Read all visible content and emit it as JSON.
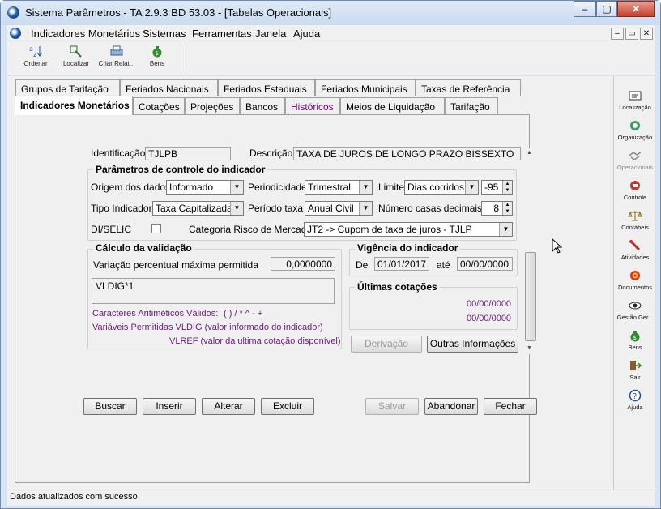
{
  "window": {
    "title": "Sistema Parâmetros -  TA 2.9.3 BD 53.03 - [Tabelas Operacionais]",
    "min_label": "‒",
    "max_label": "▢",
    "close_label": "✕"
  },
  "menubar": {
    "items": [
      "Indicadores Monetários",
      "Sistemas",
      "Ferramentas",
      "Janela",
      "Ajuda"
    ],
    "mdi_min": "‒",
    "mdi_restore": "▭",
    "mdi_close": "✕"
  },
  "toolbar": {
    "items": [
      {
        "label": "Ordenar",
        "icon": "sort-az-icon"
      },
      {
        "label": "Localizar",
        "icon": "find-icon"
      },
      {
        "label": "Criar Relat...",
        "icon": "printer-icon"
      },
      {
        "label": "Bens",
        "icon": "money-bag-icon"
      }
    ]
  },
  "sidebar": {
    "items": [
      {
        "label": "Localização",
        "icon": "location-icon"
      },
      {
        "label": "Organização",
        "icon": "organization-icon"
      },
      {
        "label": "Operacionais",
        "icon": "handshake-icon"
      },
      {
        "label": "Controle",
        "icon": "control-icon"
      },
      {
        "label": "Contábeis",
        "icon": "scale-icon"
      },
      {
        "label": "Atividades",
        "icon": "activities-icon"
      },
      {
        "label": "Documentos",
        "icon": "documents-icon"
      },
      {
        "label": "Gestão Ger...",
        "icon": "management-icon"
      },
      {
        "label": "Bens",
        "icon": "money-bag-icon"
      },
      {
        "label": "Sair",
        "icon": "exit-icon"
      },
      {
        "label": "Ajuda",
        "icon": "help-icon"
      }
    ]
  },
  "tabs": {
    "row1": [
      "Grupos de Tarifação",
      "Feriados Nacionais",
      "Feriados Estaduais",
      "Feriados Municipais",
      "Taxas de Referência"
    ],
    "row2": [
      "Indicadores Monetários",
      "Cotações",
      "Projeções",
      "Bancos",
      "Históricos",
      "Meios de Liquidação",
      "Tarifação"
    ]
  },
  "form": {
    "identificacao_label": "Identificação",
    "identificacao_value": "TJLPB",
    "descricao_label": "Descrição",
    "descricao_value": "TAXA DE JUROS DE LONGO PRAZO BISSEXTO",
    "params_title": "Parâmetros de controle do indicador",
    "origem_label": "Origem dos dados",
    "origem_value": "Informado",
    "periodicidade_label": "Periodicidade",
    "periodicidade_value": "Trimestral",
    "limite_label": "Limite",
    "limite_value": "Dias corridos",
    "limite_num": "-95",
    "tipo_label": "Tipo Indicador",
    "tipo_value": "Taxa Capitalizada",
    "periodo_label": "Período taxa",
    "periodo_value": "Anual Civil",
    "casas_label": "Número casas decimais",
    "casas_value": "8",
    "diselic_label": "DI/SELIC",
    "categoria_label": "Categoria Risco de Mercado",
    "categoria_value": "JT2 -> Cupom de taxa de juros - TJLP",
    "calculo_title": "Cálculo da validação",
    "variacao_label": "Variação percentual máxima permitida",
    "variacao_value": "0,0000000",
    "formula_value": "VLDIG*1",
    "caracteres_label": "Caracteres Aritiméticos Válidos:",
    "caracteres_value": "( ) / * ^ - +",
    "vldig_text": "Variáveis Permitidas VLDIG  (valor informado do indicador)",
    "vlref_text": "VLREF (valor da ultima cotação disponível)",
    "vigencia_title": "Vigência do indicador",
    "de_label": "De",
    "de_value": "01/01/2017",
    "ate_label": "até",
    "ate_value": "00/00/0000",
    "ultimas_title": "Últimas cotações",
    "cotacao1": "00/00/0000",
    "cotacao2": "00/00/0000",
    "derivacao_label": "Derivação",
    "outras_label": "Outras Informações"
  },
  "actions": {
    "buscar": "Buscar",
    "inserir": "Inserir",
    "alterar": "Alterar",
    "excluir": "Excluir",
    "salvar": "Salvar",
    "abandonar": "Abandonar",
    "fechar": "Fechar"
  },
  "status": {
    "text": "Dados atualizados com sucesso"
  }
}
